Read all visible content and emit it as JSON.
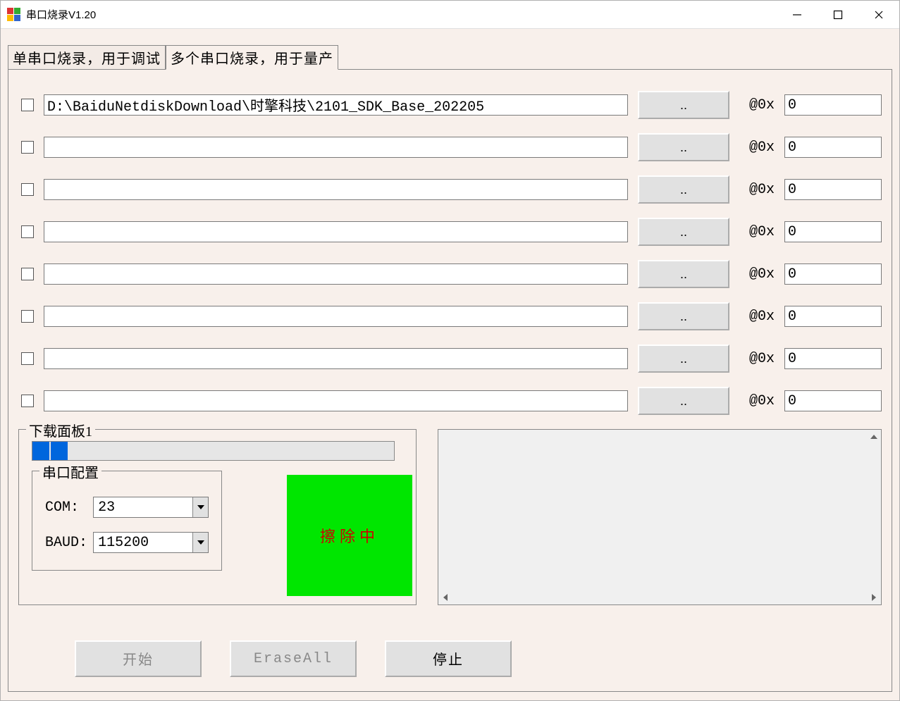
{
  "window": {
    "title": "串口烧录V1.20"
  },
  "tabs": {
    "single": "单串口烧录，用于调试",
    "multi": "多个串口烧录，用于量产"
  },
  "rows": [
    {
      "path": "D:\\BaiduNetdiskDownload\\时擎科技\\2101_SDK_Base_202205",
      "addr": "0"
    },
    {
      "path": "",
      "addr": "0"
    },
    {
      "path": "",
      "addr": "0"
    },
    {
      "path": "",
      "addr": "0"
    },
    {
      "path": "",
      "addr": "0"
    },
    {
      "path": "",
      "addr": "0"
    },
    {
      "path": "",
      "addr": "0"
    },
    {
      "path": "",
      "addr": "0"
    }
  ],
  "row_common": {
    "browse": "..",
    "at": "@0x"
  },
  "download_panel": {
    "legend": "下载面板1",
    "config_legend": "串口配置",
    "com_label": "COM:",
    "com_value": "23",
    "baud_label": "BAUD:",
    "baud_value": "115200",
    "status": "擦除中"
  },
  "actions": {
    "start": "开始",
    "erase": "EraseAll",
    "stop": "停止"
  }
}
